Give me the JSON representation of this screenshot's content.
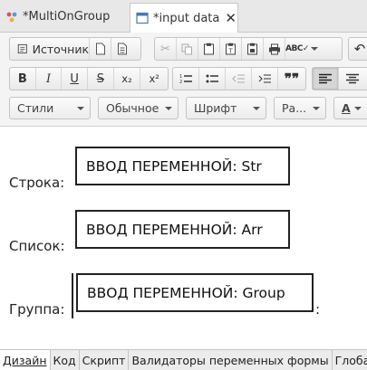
{
  "tabs": [
    {
      "label": "*MultiOnGroup"
    },
    {
      "label": "*input data"
    }
  ],
  "toolbar": {
    "source_label": "Источник",
    "styles_label": "Стили",
    "format_label": "Обычное",
    "font_label": "Шрифт",
    "size_label": "Ра...",
    "text_color_label": "A"
  },
  "editor": {
    "rows": [
      {
        "label": "Строка:",
        "variable": "ВВОД ПЕРЕМЕННОЙ: Str"
      },
      {
        "label": "Список:",
        "variable": "ВВОД ПЕРЕМЕННОЙ: Arr"
      },
      {
        "label": "Группа:",
        "variable": "ВВОД ПЕРЕМЕННОЙ: Group"
      }
    ],
    "trailing_colon": ":"
  },
  "bottom_tabs": [
    {
      "label": "Дизайн",
      "active": true
    },
    {
      "label": "Код"
    },
    {
      "label": "Скрипт"
    },
    {
      "label": "Валидаторы переменных формы"
    },
    {
      "label": "Глобал"
    }
  ],
  "icons": {
    "bold": "B",
    "italic": "I",
    "underline": "U",
    "strike": "S",
    "subscript": "x₂",
    "superscript": "x²",
    "quote": "99"
  },
  "colors": {
    "toolbar_bg": "#f4f4f4",
    "tabbar_bg": "#e8e8e8",
    "active_align_bg": "#d6d6d6"
  }
}
